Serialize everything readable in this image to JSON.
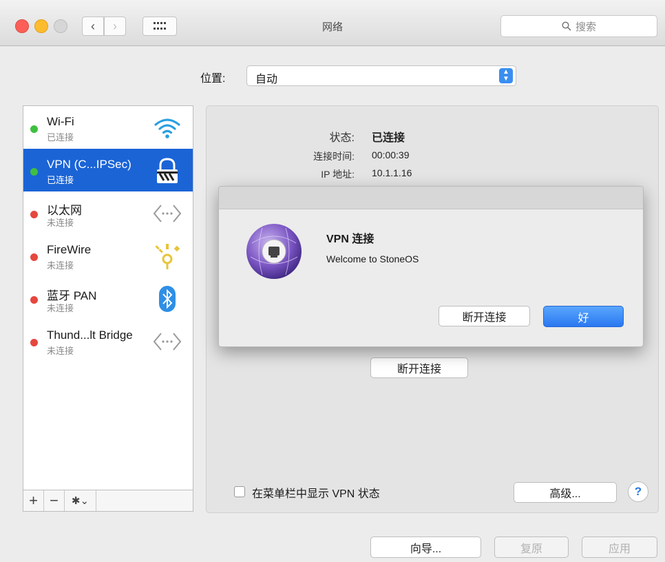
{
  "window": {
    "title": "网络",
    "search_placeholder": "搜索"
  },
  "location": {
    "label": "位置:",
    "value": "自动"
  },
  "services": [
    {
      "name": "Wi-Fi",
      "status": "已连接",
      "status_color": "#3fbf3f",
      "icon": "wifi-icon",
      "selected": false
    },
    {
      "name": "VPN (C...IPSec)",
      "status": "已连接",
      "status_color": "#3fbf3f",
      "icon": "vpn-lock-icon",
      "selected": true
    },
    {
      "name": "以太网",
      "status": "未连接",
      "status_color": "#e5473f",
      "icon": "ethernet-icon",
      "selected": false
    },
    {
      "name": "FireWire",
      "status": "未连接",
      "status_color": "#e5473f",
      "icon": "firewire-icon",
      "selected": false
    },
    {
      "name": "蓝牙 PAN",
      "status": "未连接",
      "status_color": "#e5473f",
      "icon": "bluetooth-icon",
      "selected": false
    },
    {
      "name": "Thund...lt Bridge",
      "status": "未连接",
      "status_color": "#e5473f",
      "icon": "thunderbolt-bridge-icon",
      "selected": false
    }
  ],
  "sidebar_tools": {
    "add": "+",
    "remove": "−",
    "gear": "✱⌄"
  },
  "details": {
    "status_label": "状态:",
    "status_value": "已连接",
    "time_label": "连接时间:",
    "time_value": "00:00:39",
    "ip_label": "IP 地址:",
    "ip_value": "10.1.1.16",
    "disconnect": "断开连接"
  },
  "show_vpn_menubar": {
    "label": "在菜单栏中显示 VPN 状态",
    "checked": false
  },
  "advanced": "高级...",
  "help": "?",
  "footer": {
    "assistant": "向导...",
    "revert": "复原",
    "apply": "应用"
  },
  "dialog": {
    "title": "VPN 连接",
    "message": "Welcome to StoneOS",
    "disconnect": "断开连接",
    "ok": "好"
  },
  "colors": {
    "accent": "#1b64d6",
    "connected": "#3fbf3f",
    "disconnected": "#e5473f"
  }
}
